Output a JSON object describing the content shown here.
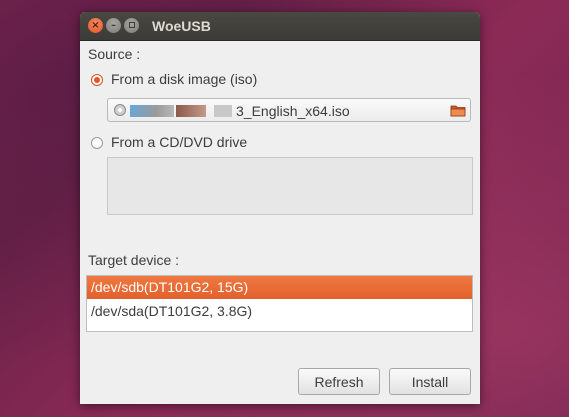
{
  "window": {
    "title": "WoeUSB",
    "controls": {
      "close_glyph": "×",
      "minimize_glyph": "–",
      "maximize_glyph": ""
    }
  },
  "source": {
    "heading": "Source :",
    "disk_image_option": {
      "label": "From a disk image (iso)",
      "selected": true
    },
    "file_path_visible_suffix": "3_English_x64.iso",
    "file_path_redacted": true,
    "cd_dvd_option": {
      "label": "From a CD/DVD drive",
      "selected": false
    }
  },
  "target": {
    "heading": "Target device :",
    "devices": [
      {
        "label": "/dev/sdb(DT101G2,  15G)",
        "selected": true
      },
      {
        "label": "/dev/sda(DT101G2,  3.8G)",
        "selected": false
      }
    ]
  },
  "buttons": {
    "refresh": "Refresh",
    "install": "Install"
  },
  "colors": {
    "accent": "#e95420",
    "titlebar": "#3c3b37",
    "window_bg": "#efefef"
  },
  "icons": {
    "file_type": "disc-icon",
    "browse": "folder-open-icon"
  }
}
